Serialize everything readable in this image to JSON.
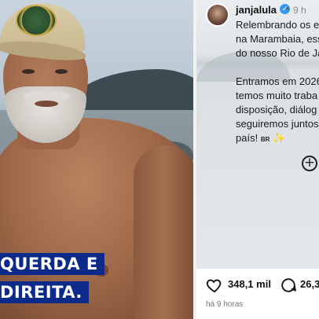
{
  "photo": {
    "caption_line1": "QUERDA E",
    "caption_line2": "DIREITA."
  },
  "post": {
    "username": "janjalula",
    "time": "9 h",
    "lines": [
      "Relembrando os e",
      "na Marambaia, ess",
      "do nosso Rio de Ja"
    ],
    "lines2": [
      "Entramos em 2026",
      "temos muito traba",
      "disposição, diálog",
      "seguiremos juntos",
      "país!"
    ],
    "flag_text": "BR",
    "likes": "348,1 mil",
    "comments": "26,3",
    "posted_ago": "há 9 horas"
  },
  "colors": {
    "caption_bg": "#0b2a8a",
    "verified": "#3897f0"
  }
}
